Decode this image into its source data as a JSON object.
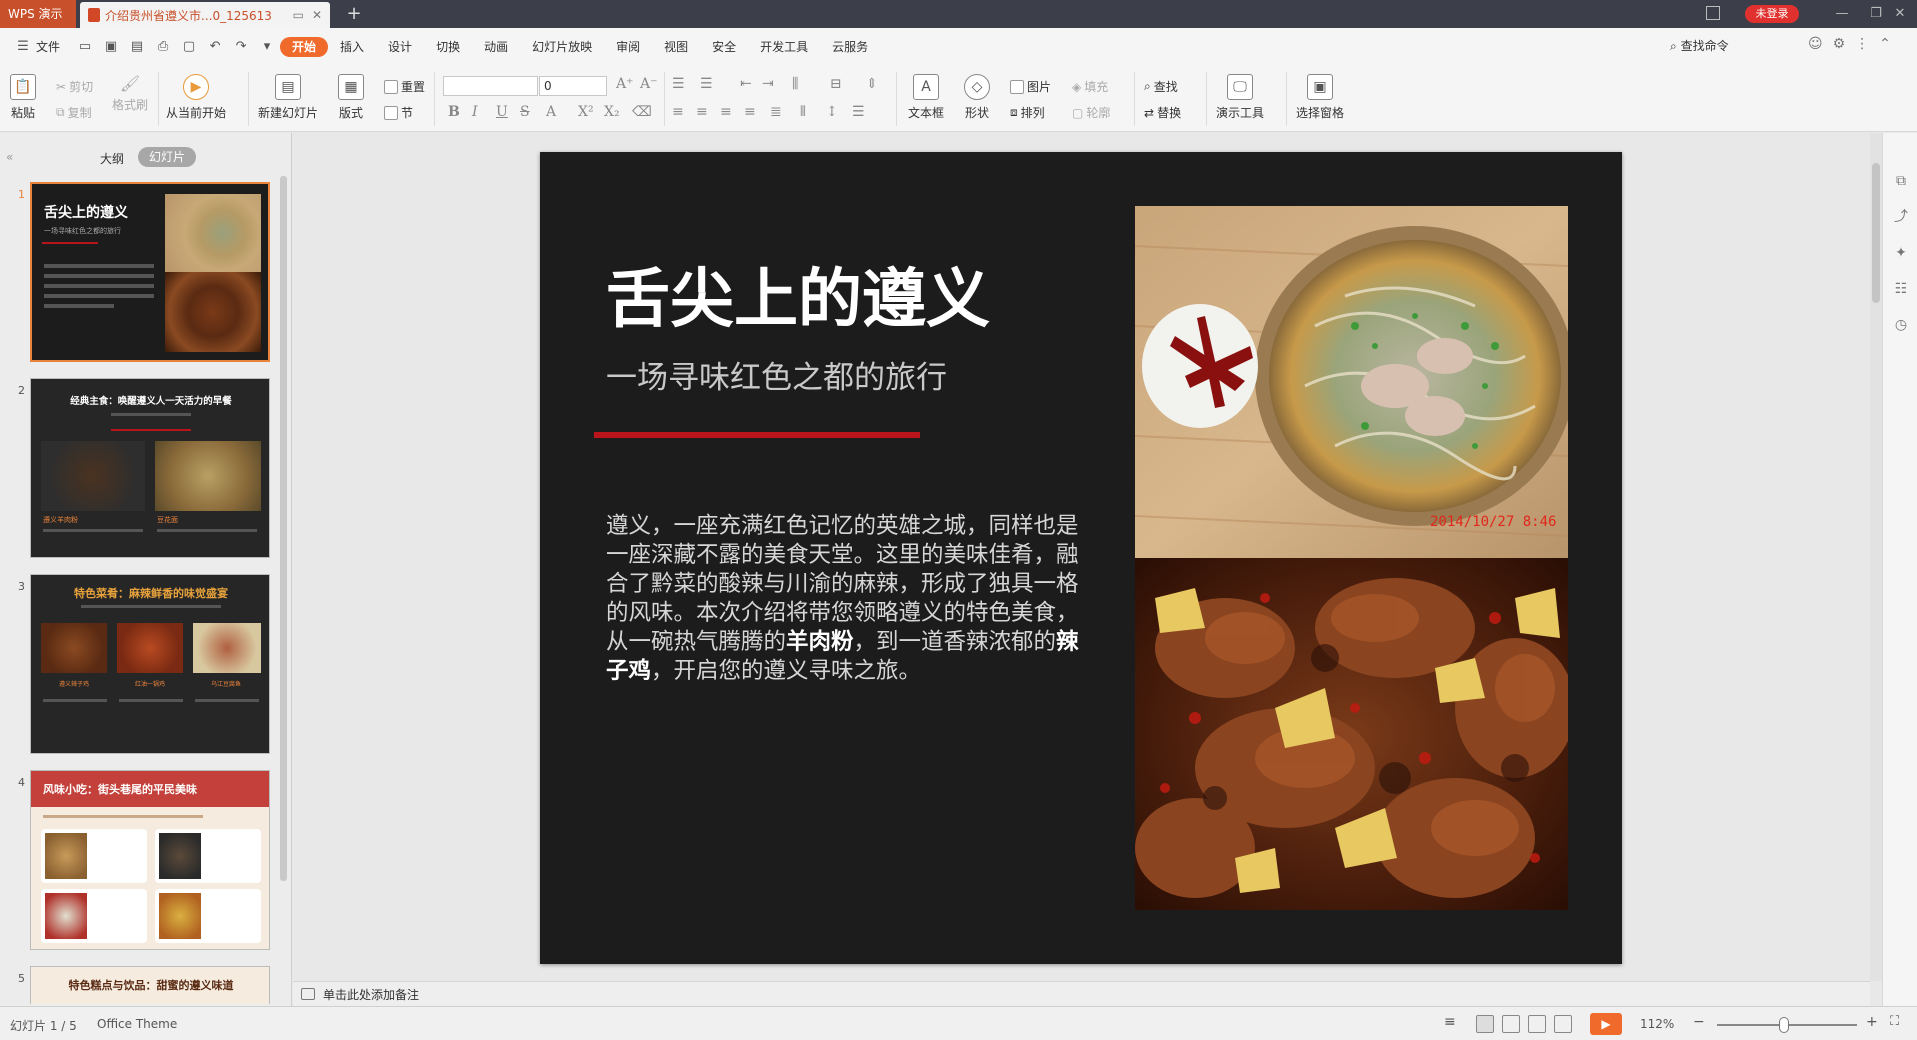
{
  "titlebar": {
    "app_name": "WPS 演示",
    "doc_tab": "介绍贵州省遵义市...0_125613",
    "login": "未登录"
  },
  "menu": {
    "file": "文件",
    "tabs": [
      "开始",
      "插入",
      "设计",
      "切换",
      "动画",
      "幻灯片放映",
      "审阅",
      "视图",
      "安全",
      "开发工具",
      "云服务"
    ],
    "search": "查找命令"
  },
  "ribbon": {
    "paste": "粘贴",
    "cut": "剪切",
    "copy": "复制",
    "format_painter": "格式刷",
    "from_current": "从当前开始",
    "new_slide": "新建幻灯片",
    "layout": "版式",
    "reset": "重置",
    "section": "节",
    "font_size": "0",
    "textbox": "文本框",
    "shape": "形状",
    "picture": "图片",
    "fill": "填充",
    "arrange": "排列",
    "outline": "轮廓",
    "find": "查找",
    "replace": "替换",
    "presentation_tools": "演示工具",
    "selection_pane": "选择窗格"
  },
  "left_panel": {
    "tab_outline": "大纲",
    "tab_slides": "幻灯片",
    "slides": [
      {
        "num": "1",
        "title": "舌尖上的遵义",
        "subtitle": "一场寻味红色之都的旅行"
      },
      {
        "num": "2",
        "title": "经典主食：唤醒遵义人一天活力的早餐",
        "cap1": "遵义羊肉粉",
        "cap2": "豆花面"
      },
      {
        "num": "3",
        "title": "特色菜肴：麻辣鲜香的味觉盛宴",
        "cap1": "遵义辣子鸡",
        "cap2": "红油一锅鸡",
        "cap3": "乌江豆腐鱼"
      },
      {
        "num": "4",
        "title": "风味小吃：街头巷尾的平民美味"
      },
      {
        "num": "5",
        "title": "特色糕点与饮品：甜蜜的遵义味道"
      }
    ]
  },
  "slide": {
    "title": "舌尖上的遵义",
    "subtitle": "一场寻味红色之都的旅行",
    "body_1": "遵义，一座充满红色记忆的英雄之城，同样也是一座深藏不露的美食天堂。这里的美味佳肴，融合了黔菜的酸辣与川渝的麻辣，形成了独具一格的风味。本次介绍将带您领略遵义的特色美食，从一碗热气腾腾的",
    "body_bold_1": "羊肉粉",
    "body_2": "，到一道香辣浓郁的",
    "body_bold_2": "辣子鸡",
    "body_3": "，开启您的遵义寻味之旅。",
    "photo_stamp": "2014/10/27  8:46"
  },
  "notes": {
    "placeholder": "单击此处添加备注"
  },
  "status": {
    "slide_count": "幻灯片 1 / 5",
    "theme": "Office Theme",
    "zoom": "112%",
    "zoom_level_fraction": 0.48
  },
  "colors": {
    "accent": "#ef6a2b",
    "slide_bg": "#1c1c1c",
    "red_bar": "#b8141a"
  }
}
